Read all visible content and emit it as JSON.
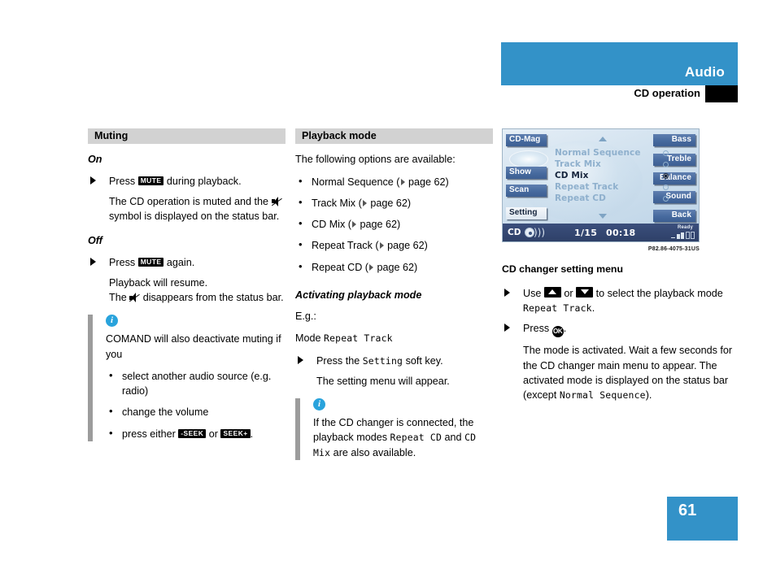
{
  "header": {
    "title": "Audio",
    "subtitle": "CD operation"
  },
  "footer": {
    "page_number": "61"
  },
  "colors": {
    "brand_blue": "#3392c8",
    "section_head_gray": "#d2d2d2",
    "note_bar_gray": "#9c9c9c",
    "info_icon_blue": "#29a3dc",
    "display_softkey_blue": "#476a9e",
    "display_status_navy": "#334773"
  },
  "column_left": {
    "section_title": "Muting",
    "on": {
      "heading": "On",
      "step": {
        "pre": "Press ",
        "key": "MUTE",
        "post": " during playback."
      },
      "result_a": "The CD operation is muted and the ",
      "result_b": " symbol is displayed on the status bar."
    },
    "off": {
      "heading": "Off",
      "step": {
        "pre": "Press ",
        "key": "MUTE",
        "post": " again."
      },
      "result_1": "Playback will resume.",
      "result_2a": "The ",
      "result_2b": " disappears from the status bar."
    },
    "note": {
      "icon": "info-icon",
      "text": "COMAND will also deactivate muting if you",
      "items": [
        {
          "text": "select another audio source (e.g. radio)"
        },
        {
          "text": "change the volume"
        }
      ],
      "last_item": {
        "pre": "press either ",
        "key1": "-SEEK",
        "mid": " or ",
        "key2": "SEEK+",
        "post": "."
      }
    }
  },
  "column_middle": {
    "section_title": "Playback mode",
    "intro": "The following options are available:",
    "options": [
      {
        "name": "Normal Sequence",
        "ref": "page 62"
      },
      {
        "name": "Track Mix",
        "ref": "page 62"
      },
      {
        "name": "CD Mix",
        "ref": "page 62"
      },
      {
        "name": "Repeat Track",
        "ref": "page 62"
      },
      {
        "name": "Repeat CD",
        "ref": "page 62"
      }
    ],
    "activating": {
      "heading": "Activating playback mode",
      "eg": "E.g.:",
      "mode_label": "Mode ",
      "mode_value": "Repeat Track",
      "step_pre": "Press the ",
      "step_key": "Setting",
      "step_post": " soft key.",
      "result": "The setting menu will appear."
    },
    "note": {
      "icon": "info-icon",
      "part1": "If the CD changer is connected, the playback modes ",
      "mono1": "Repeat CD",
      "part2": " and ",
      "mono2": "CD Mix",
      "part3": " are also available."
    }
  },
  "column_right": {
    "display": {
      "left_softkeys": [
        {
          "label": "CD-Mag",
          "selected": false
        },
        {
          "label": "Show",
          "selected": false
        },
        {
          "label": "Scan",
          "selected": false
        },
        {
          "label": "Setting",
          "selected": true
        }
      ],
      "right_softkeys": [
        {
          "label": "Bass",
          "selected": false
        },
        {
          "label": "Treble",
          "selected": false
        },
        {
          "label": "Balance",
          "selected": false
        },
        {
          "label": "Sound",
          "selected": false
        },
        {
          "label": "Back",
          "selected": false
        }
      ],
      "menu_items": [
        {
          "label": "Normal Sequence",
          "selected": false
        },
        {
          "label": "Track Mix",
          "selected": false
        },
        {
          "label": "CD Mix",
          "selected": true
        },
        {
          "label": "Repeat Track",
          "selected": false
        },
        {
          "label": "Repeat CD",
          "selected": false
        }
      ],
      "status_bar": {
        "source": "CD",
        "track": "1/15",
        "time": "00:18",
        "ready_label": "Ready"
      }
    },
    "figure_caption": "P82.86-4075-31US",
    "heading": "CD changer setting menu",
    "step1": {
      "pre": "Use ",
      "mid": " or ",
      "post": " to select the playback mode ",
      "mono": "Repeat Track",
      "end": "."
    },
    "step2": {
      "pre": "Press ",
      "key": "OK",
      "post": "."
    },
    "result": {
      "part1": "The mode is activated. Wait a few seconds for the CD changer main menu to appear. The activated mode is displayed on the status bar (except ",
      "mono": "Normal Sequence",
      "part2": ")."
    }
  }
}
